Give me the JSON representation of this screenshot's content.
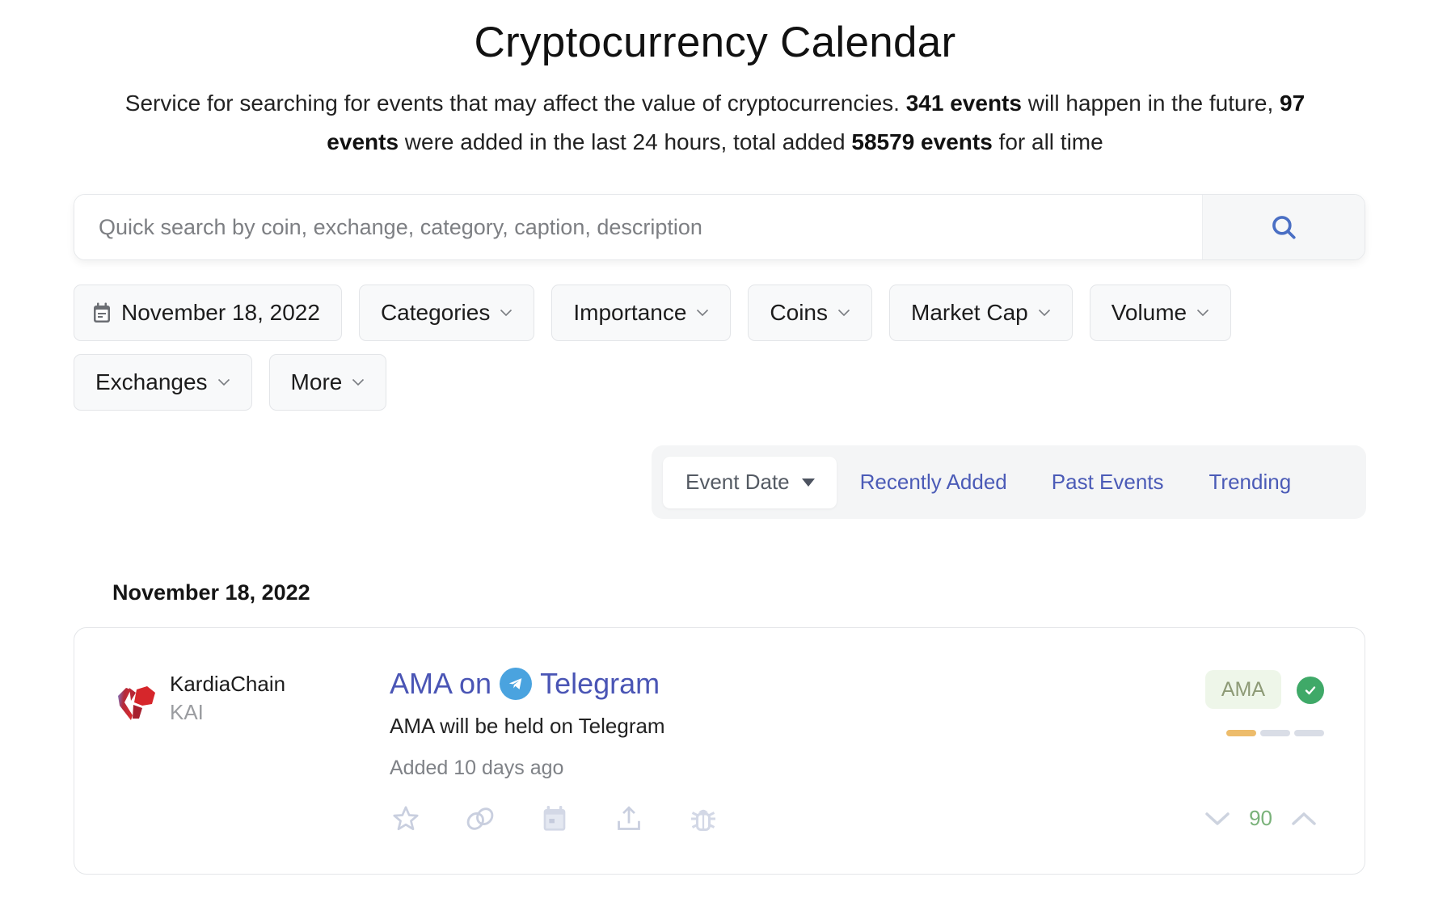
{
  "page": {
    "title": "Cryptocurrency Calendar",
    "description": {
      "part1": "Service for searching for events that may affect the value of cryptocurrencies. ",
      "future_events": "341 events",
      "part2": " will happen in the future, ",
      "added_24h": "97 events",
      "part3": " were added in the last 24 hours, total added ",
      "total_events": "58579 events",
      "part4": " for all time"
    }
  },
  "search": {
    "placeholder": "Quick search by coin, exchange, category, caption, description",
    "value": "",
    "button_icon": "search-icon"
  },
  "filters": [
    {
      "label": "November 18, 2022",
      "icon": "calendar-icon"
    },
    {
      "label": "Categories",
      "icon": "chevron-down-icon"
    },
    {
      "label": "Importance",
      "icon": "chevron-down-icon"
    },
    {
      "label": "Coins",
      "icon": "chevron-down-icon"
    },
    {
      "label": "Market Cap",
      "icon": "chevron-down-icon"
    },
    {
      "label": "Volume",
      "icon": "chevron-down-icon"
    },
    {
      "label": "Exchanges",
      "icon": "chevron-down-icon"
    },
    {
      "label": "More",
      "icon": "chevron-down-icon"
    }
  ],
  "sort_tabs": [
    {
      "label": "Event Date",
      "active": true,
      "icon": "caret-down-icon"
    },
    {
      "label": "Recently Added",
      "active": false
    },
    {
      "label": "Past Events",
      "active": false
    },
    {
      "label": "Trending",
      "active": false
    }
  ],
  "events_group": {
    "date": "November 18, 2022",
    "events": [
      {
        "coin_name": "KardiaChain",
        "coin_symbol": "KAI",
        "title_prefix": "AMA on",
        "title_platform": "Telegram",
        "description": "AMA will be held on Telegram",
        "added": "Added 10 days ago",
        "category_badge": "AMA",
        "verified": true,
        "importance_level": 1,
        "importance_max": 3,
        "votes": "90",
        "actions": [
          "star-icon",
          "link-icon",
          "calendar-add-icon",
          "share-icon",
          "bug-report-icon"
        ]
      }
    ]
  },
  "colors": {
    "link": "#4a55b5",
    "verified": "#3fa968",
    "importance_on": "#edbc6b",
    "importance_off": "#d9dde6",
    "badge_bg": "#eef6e9",
    "vote_count": "#7ab27a"
  }
}
